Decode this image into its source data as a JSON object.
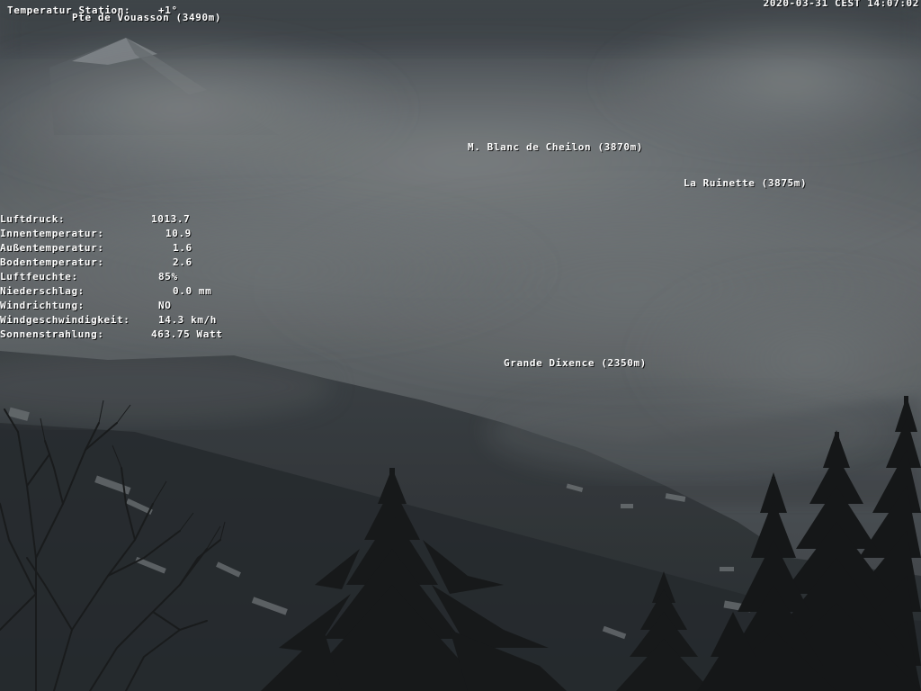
{
  "overlay": {
    "station_temp_label": "Temperatur Station:",
    "station_temp_value": "+1°",
    "timestamp": "2020-03-31 CEST 14:07:02"
  },
  "peaks": {
    "vouasson": "Pte de Vouasson (3490m)",
    "blanc_de_cheilon": "M. Blanc de Cheilon (3870m)",
    "ruinette": "La Ruinette (3875m)",
    "grande_dixence": "Grande Dixence (2350m)"
  },
  "weather": [
    {
      "label": "Luftdruck:",
      "value": "1013.7"
    },
    {
      "label": "Innentemperatur:",
      "value": "10.9"
    },
    {
      "label": "Außentemperatur:",
      "value": "1.6"
    },
    {
      "label": "Bodentemperatur:",
      "value": "2.6"
    },
    {
      "label": "Luftfeuchte:",
      "value": "85%"
    },
    {
      "label": "Niederschlag:",
      "value": "0.0 mm"
    },
    {
      "label": "Windrichtung:",
      "value": "NO"
    },
    {
      "label": "Windgeschwindigkeit:",
      "value": "14.3 km/h"
    },
    {
      "label": "Sonnenstrahlung:",
      "value": "463.75 Watt"
    }
  ],
  "colors": {
    "sky_top": "#45494e",
    "cloud": "#767a7c",
    "ridge": "#2c3034",
    "valley": "#262a2e",
    "tree": "#141516",
    "snow": "#8a8e92"
  }
}
